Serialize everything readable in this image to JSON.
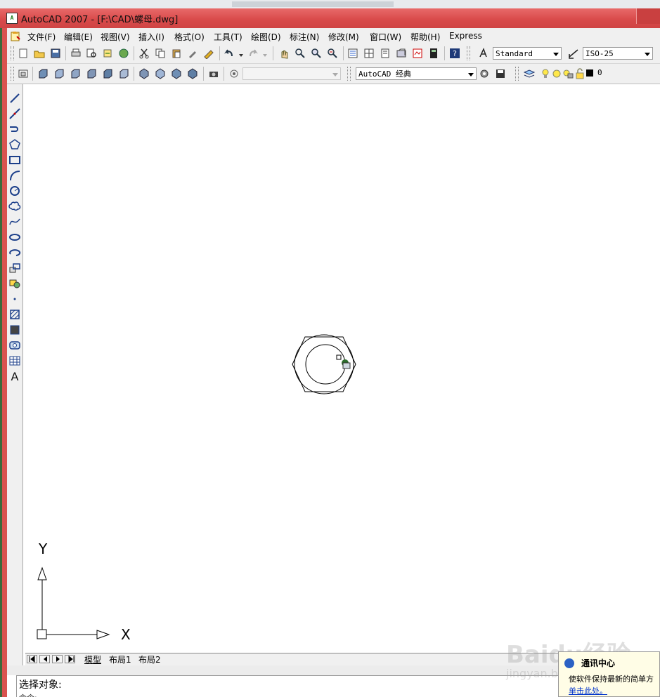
{
  "window": {
    "title": "AutoCAD 2007 - [F:\\CAD\\螺母.dwg]",
    "app_icon_text": "A"
  },
  "menubar": {
    "items": [
      "文件(F)",
      "编辑(E)",
      "视图(V)",
      "插入(I)",
      "格式(O)",
      "工具(T)",
      "绘图(D)",
      "标注(N)",
      "修改(M)",
      "窗口(W)",
      "帮助(H)",
      "Express"
    ]
  },
  "toolbar1": {
    "text_style": "Standard",
    "dim_style": "ISO-25"
  },
  "toolbar2": {
    "view_combo": "",
    "workspace": "AutoCAD 经典",
    "layer": "0"
  },
  "ucs": {
    "y_label": "Y",
    "x_label": "X"
  },
  "layout_tabs": [
    "模型",
    "布局1",
    "布局2"
  ],
  "command": {
    "prompt": "选择对象:",
    "history": "命令:"
  },
  "notification": {
    "title": "通讯中心",
    "body": "使软件保持最新的简单方",
    "link": "单击此处。"
  },
  "watermark": {
    "main": "Baidu经验",
    "sub": "jingyan.baidu.com"
  },
  "colors": {
    "title_bar": "#d94b4b",
    "frame": "#d9534f",
    "link": "#0033cc"
  }
}
